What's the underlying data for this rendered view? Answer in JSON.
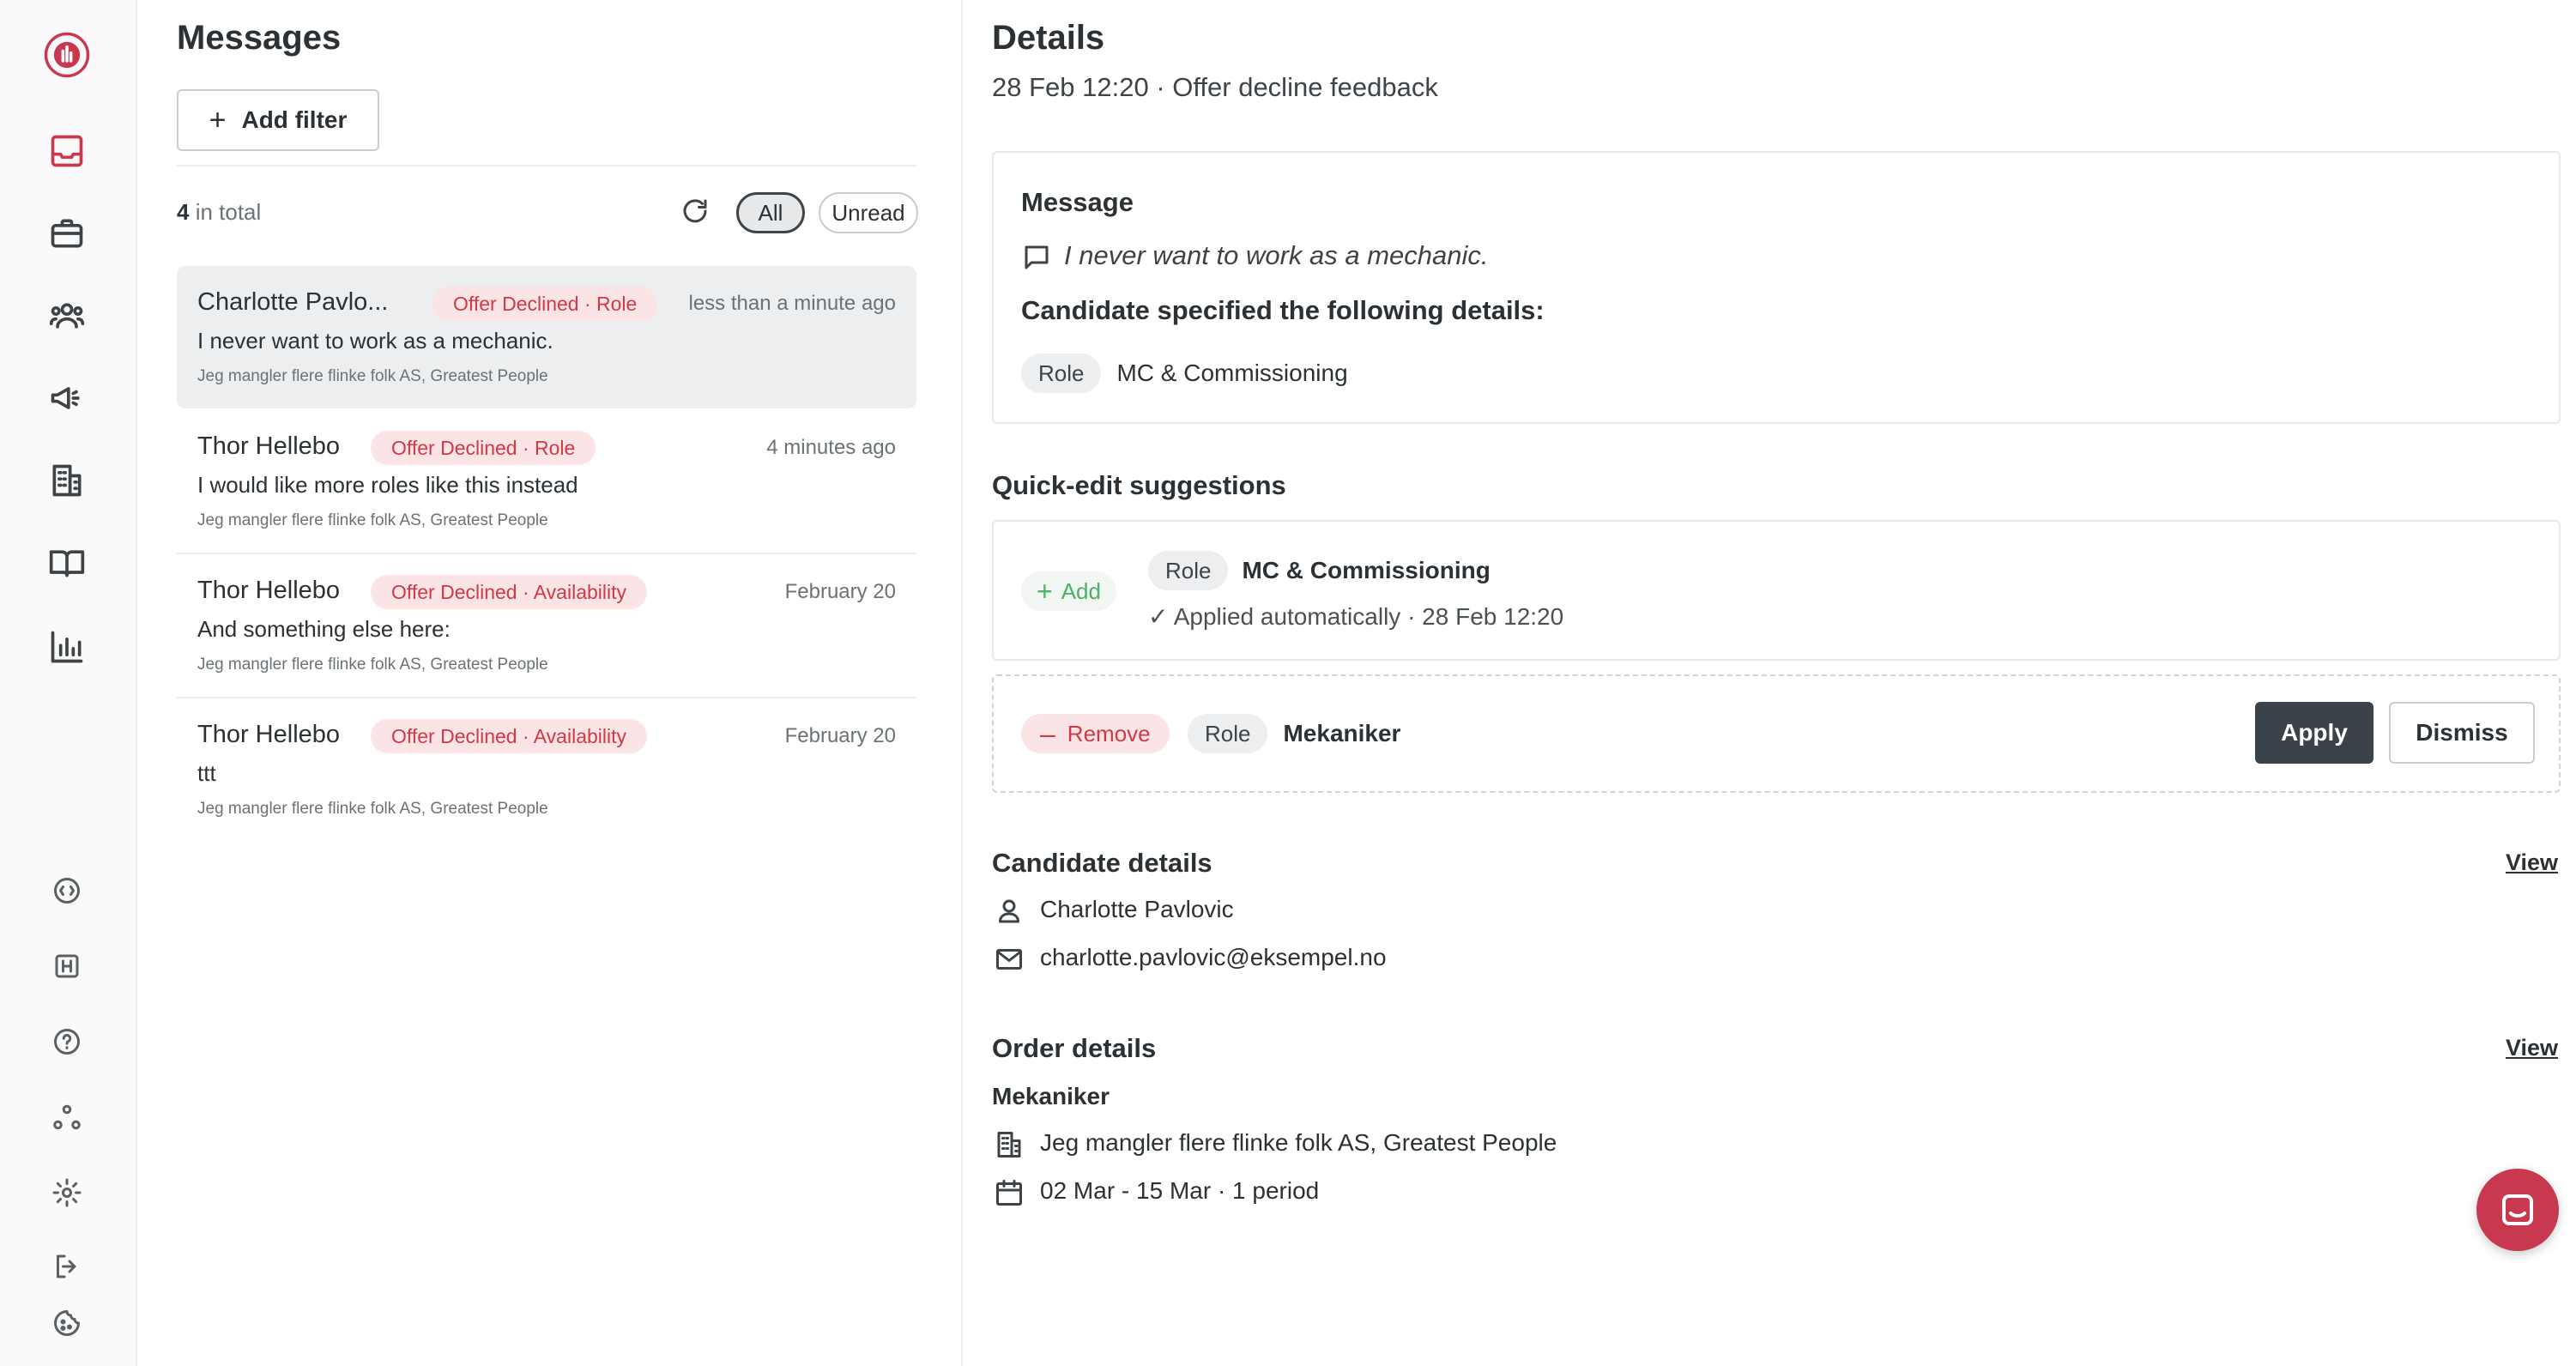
{
  "messages_panel": {
    "title": "Messages",
    "add_filter_label": "Add filter",
    "total_count": "4",
    "total_suffix": " in total",
    "filter_all": "All",
    "filter_unread": "Unread",
    "items": [
      {
        "name": "Charlotte Pavlo...",
        "badge": "Offer Declined · Role",
        "time": "less than a minute ago",
        "text": "I never want to work as a mechanic.",
        "sub": "Jeg mangler flere flinke folk AS, Greatest People"
      },
      {
        "name": "Thor Hellebo",
        "badge": "Offer Declined · Role",
        "time": "4 minutes ago",
        "text": "I would like more roles like this instead",
        "sub": "Jeg mangler flere flinke folk AS, Greatest People"
      },
      {
        "name": "Thor Hellebo",
        "badge": "Offer Declined · Availability",
        "time": "February 20",
        "text": "And something else here:",
        "sub": "Jeg mangler flere flinke folk AS, Greatest People"
      },
      {
        "name": "Thor Hellebo",
        "badge": "Offer Declined · Availability",
        "time": "February 20",
        "text": "ttt",
        "sub": "Jeg mangler flere flinke folk AS, Greatest People"
      }
    ]
  },
  "details": {
    "title": "Details",
    "subtitle": "28 Feb 12:20 · Offer decline feedback",
    "message_card": {
      "heading": "Message",
      "quote": "I never want to work as a mechanic.",
      "specified_heading": "Candidate specified the following details:",
      "tag": "Role",
      "value": "MC & Commissioning"
    },
    "quick_edit": {
      "heading": "Quick-edit suggestions",
      "suggestion1": {
        "action": "Add",
        "tag": "Role",
        "value": "MC & Commissioning",
        "status": "✓ Applied automatically · 28 Feb 12:20"
      },
      "suggestion2": {
        "action": "Remove",
        "tag": "Role",
        "value": "Mekaniker",
        "apply_label": "Apply",
        "dismiss_label": "Dismiss"
      }
    },
    "candidate": {
      "heading": "Candidate details",
      "view_label": "View",
      "name": "Charlotte Pavlovic",
      "email": "charlotte.pavlovic@eksempel.no"
    },
    "order": {
      "heading": "Order details",
      "view_label": "View",
      "role": "Mekaniker",
      "company": "Jeg mangler flere flinke folk AS, Greatest People",
      "dates": "02 Mar - 15 Mar · 1 period"
    }
  },
  "colors": {
    "brand": "#c8394f",
    "badge_bg": "#fbe4e6",
    "badge_text": "#cf3a46",
    "apply_bg": "#3a4349",
    "add_green": "#4caf6a"
  },
  "icons": {
    "sidebar": [
      "logo-icon",
      "inbox-icon",
      "briefcase-icon",
      "users-icon",
      "megaphone-icon",
      "building-icon",
      "book-icon",
      "bar-chart-icon",
      "api-icon",
      "hospital-icon",
      "help-icon",
      "integrations-icon",
      "settings-icon",
      "logout-icon",
      "cookie-icon"
    ]
  }
}
